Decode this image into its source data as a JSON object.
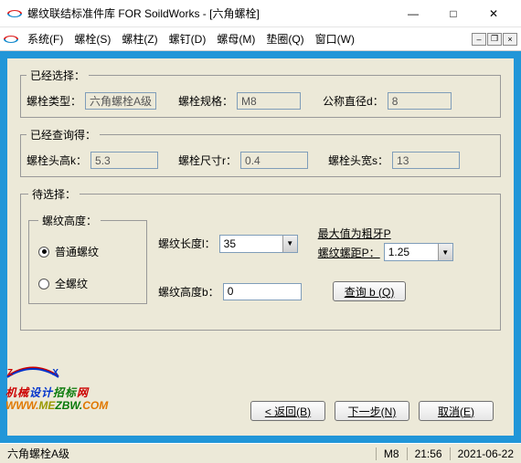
{
  "window": {
    "title": "螺纹联结标准件库 FOR SoildWorks - [六角螺栓]",
    "controls": {
      "min": "—",
      "max": "□",
      "close": "✕"
    }
  },
  "menu": {
    "items": [
      "系统(F)",
      "螺栓(S)",
      "螺柱(Z)",
      "螺钉(D)",
      "螺母(M)",
      "垫圈(Q)",
      "窗口(W)"
    ],
    "mdi": {
      "min": "–",
      "restore": "❐",
      "close": "×"
    }
  },
  "selected": {
    "legend": "已经选择：",
    "type_label": "螺栓类型：",
    "type_value": "六角螺栓A级",
    "spec_label": "螺栓规格：",
    "spec_value": "M8",
    "dia_label": "公称直径d：",
    "dia_value": "8"
  },
  "queried": {
    "legend": "已经查询得：",
    "k_label": "螺栓头高k：",
    "k_value": "5.3",
    "r_label": "螺栓尺寸r：",
    "r_value": "0.4",
    "s_label": "螺栓头宽s：",
    "s_value": "13"
  },
  "pending": {
    "legend": "待选择：",
    "height_group": "螺纹高度：",
    "radio_normal": "普通螺纹",
    "radio_full": "全螺纹",
    "len_label": "螺纹长度l：",
    "len_value": "35",
    "pitch_hint": "最大值为粗牙P",
    "pitch_label": "螺纹螺距P：",
    "pitch_value": "1.25",
    "b_label": "螺纹高度b：",
    "b_value": "0",
    "query_btn": "查询 b (Q)"
  },
  "nav": {
    "back": "< 返回(B)",
    "next": "下一步(N)",
    "cancel": "取消(E)"
  },
  "status": {
    "file": "六角螺栓A级",
    "spec": "M8",
    "time": "21:56",
    "date": "2021-06-22"
  },
  "watermark": {
    "z": "Z",
    "x": "X",
    "cn1": "机械",
    "cn2": "设计",
    "cn3": "招标",
    "cn4": "网",
    "url1": "WWW.",
    "url2": "ME",
    "url3": "ZBW.",
    "url4": "COM"
  }
}
